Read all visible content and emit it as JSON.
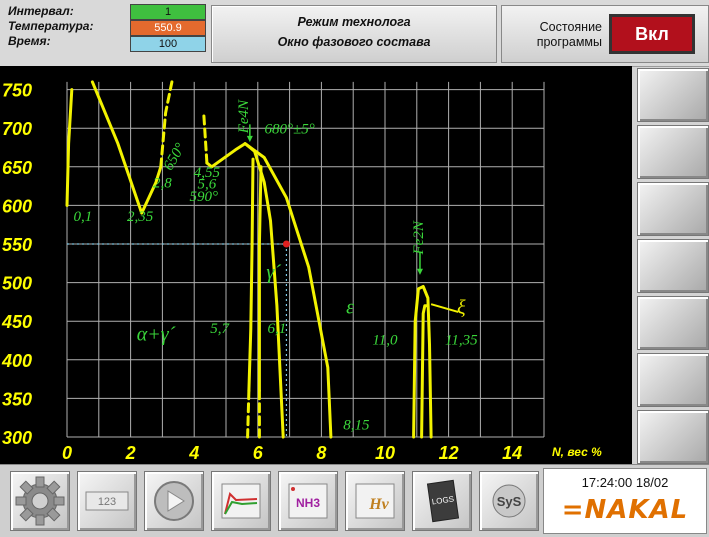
{
  "header": {
    "interval_label": "Интервал:",
    "interval_value": "1",
    "temperature_label": "Температура:",
    "temperature_value": "550.9",
    "time_label": "Время:",
    "time_value": "100",
    "mode_title": "Режим технолога",
    "mode_subtitle": "Окно фазового состава",
    "state_label_line1": "Состояние",
    "state_label_line2": "программы",
    "on_button_label": "Вкл"
  },
  "colors": {
    "interval_bg": "#3fbf3f",
    "temperature_bg": "#e46a2e",
    "time_bg": "#8fd3e8",
    "curve": "#f2f200",
    "label": "#3ad63a",
    "axis": "#ffff00",
    "grid": "#b0b0b0",
    "cursor": "#7ec8e3",
    "marker": "#e02020"
  },
  "chart_data": {
    "type": "line",
    "xlabel": "N, вес %",
    "ylabel": "",
    "xlim": [
      0,
      15
    ],
    "ylim": [
      300,
      760
    ],
    "x_ticks": [
      "0",
      "2",
      "4",
      "6",
      "8",
      "10",
      "12",
      "14"
    ],
    "y_ticks": [
      "750",
      "700",
      "650",
      "600",
      "550",
      "500",
      "450",
      "400",
      "350",
      "300"
    ],
    "grid": true,
    "cursor_point": {
      "x": 6.9,
      "y": 550
    },
    "curves": [
      {
        "style": "solid",
        "points": [
          [
            0,
            600
          ],
          [
            0.05,
            680
          ],
          [
            0.15,
            750
          ]
        ]
      },
      {
        "style": "solid",
        "points": [
          [
            0.8,
            760
          ],
          [
            1.6,
            680
          ],
          [
            2.35,
            590
          ],
          [
            2.8,
            630
          ],
          [
            2.95,
            650
          ]
        ]
      },
      {
        "style": "dashed",
        "points": [
          [
            2.95,
            650
          ],
          [
            3.1,
            720
          ],
          [
            3.3,
            760
          ]
        ]
      },
      {
        "style": "solid",
        "points": [
          [
            4.4,
            655
          ],
          [
            4.55,
            650
          ],
          [
            5.3,
            672
          ],
          [
            5.6,
            680
          ],
          [
            5.9,
            670
          ],
          [
            6.2,
            630
          ],
          [
            6.4,
            580
          ],
          [
            6.6,
            470
          ],
          [
            6.8,
            300
          ]
        ]
      },
      {
        "style": "dashed",
        "points": [
          [
            4.4,
            655
          ],
          [
            4.3,
            720
          ]
        ]
      },
      {
        "style": "solid",
        "points": [
          [
            5.6,
            680
          ],
          [
            6.2,
            662
          ],
          [
            6.9,
            610
          ],
          [
            7.6,
            520
          ],
          [
            8.2,
            390
          ],
          [
            8.3,
            300
          ]
        ]
      },
      {
        "style": "solid",
        "points": [
          [
            5.85,
            660
          ],
          [
            5.82,
            550
          ],
          [
            5.78,
            440
          ],
          [
            5.72,
            360
          ]
        ]
      },
      {
        "style": "dashed",
        "points": [
          [
            5.72,
            360
          ],
          [
            5.68,
            300
          ]
        ]
      },
      {
        "style": "solid",
        "points": [
          [
            6.1,
            650
          ],
          [
            6.05,
            550
          ],
          [
            6.05,
            430
          ],
          [
            6.05,
            360
          ]
        ]
      },
      {
        "style": "dashed",
        "points": [
          [
            6.05,
            360
          ],
          [
            6.05,
            300
          ]
        ]
      },
      {
        "style": "solid",
        "points": [
          [
            10.9,
            300
          ],
          [
            10.95,
            450
          ],
          [
            11.05,
            492
          ],
          [
            11.2,
            495
          ],
          [
            11.35,
            480
          ],
          [
            11.4,
            420
          ],
          [
            11.45,
            300
          ]
        ]
      },
      {
        "style": "solid",
        "points": [
          [
            11.15,
            300
          ],
          [
            11.2,
            460
          ],
          [
            11.25,
            470
          ],
          [
            11.35,
            470
          ]
        ]
      }
    ],
    "annotations": [
      {
        "text": "0,1",
        "x": 0.5,
        "y": 580
      },
      {
        "text": "2,35",
        "x": 2.3,
        "y": 580
      },
      {
        "text": "2,8",
        "x": 3.0,
        "y": 623
      },
      {
        "text": "650°",
        "x": 3.5,
        "y": 660
      },
      {
        "text": "4,55",
        "x": 4.4,
        "y": 637
      },
      {
        "text": "5,6",
        "x": 4.4,
        "y": 622
      },
      {
        "text": "590°",
        "x": 4.3,
        "y": 606
      },
      {
        "text": "680°±5°",
        "x": 7.0,
        "y": 693
      },
      {
        "text": "Fe4N",
        "x": 5.7,
        "y": 715
      },
      {
        "text": "Fe2N",
        "x": 11.2,
        "y": 558
      },
      {
        "text": "γ´",
        "x": 6.5,
        "y": 505
      },
      {
        "text": "ε",
        "x": 8.9,
        "y": 460
      },
      {
        "text": "ξ",
        "x": 12.4,
        "y": 460
      },
      {
        "text": "α+γ´",
        "x": 2.8,
        "y": 425
      },
      {
        "text": "5,7",
        "x": 4.8,
        "y": 435
      },
      {
        "text": "6,1",
        "x": 6.6,
        "y": 435
      },
      {
        "text": "11,0",
        "x": 10.0,
        "y": 420
      },
      {
        "text": "11,35",
        "x": 12.4,
        "y": 420
      },
      {
        "text": "8,15",
        "x": 9.1,
        "y": 310
      }
    ]
  },
  "toolbar": {
    "items": [
      "gear-icon",
      "counter-123-icon",
      "play-icon",
      "graph-icon",
      "nh3-icon",
      "hardness-hv-icon",
      "logs-icon",
      "sys-icon"
    ],
    "counter_label": "123",
    "nh3_label": "NH3",
    "hv_label": "Hv",
    "logs_label": "LOGS",
    "sys_label": "SyS"
  },
  "status": {
    "clock": "17:24:00 18/02",
    "logo": "NAKAL"
  }
}
